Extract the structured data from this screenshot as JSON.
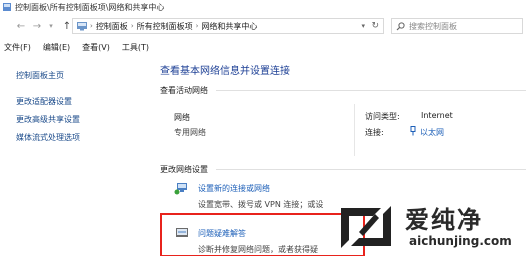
{
  "window": {
    "title": "控制面板\\所有控制面板项\\网络和共享中心"
  },
  "address": {
    "segments": [
      "控制面板",
      "所有控制面板项",
      "网络和共享中心"
    ],
    "search_placeholder": "搜索控制面板"
  },
  "menu": [
    "文件(F)",
    "编辑(E)",
    "查看(V)",
    "工具(T)"
  ],
  "sidebar": {
    "items": [
      {
        "label": "控制面板主页"
      },
      {
        "label": "更改适配器设置"
      },
      {
        "label": "更改高级共享设置"
      },
      {
        "label": "媒体流式处理选项"
      }
    ]
  },
  "main": {
    "heading": "查看基本网络信息并设置连接",
    "active_networks_label": "查看活动网络",
    "network": {
      "name": "网络",
      "type": "专用网络",
      "access_type_label": "访问类型:",
      "access_type_value": "Internet",
      "connections_label": "连接:",
      "connections_value": "以太网"
    },
    "change_settings_label": "更改网络设置",
    "tasks": [
      {
        "title": "设置新的连接或网络",
        "description": "设置宽带、拨号或 VPN 连接；或设",
        "icon": "network-setup-icon"
      },
      {
        "title": "问题疑难解答",
        "description": "诊断并修复网络问题，或者获得疑",
        "icon": "troubleshoot-icon"
      }
    ]
  },
  "watermark": {
    "title": "爱纯净",
    "url": "aichunjing.com"
  },
  "colors": {
    "link": "#1c5fb8",
    "heading": "#1c3f95",
    "highlight_border": "#e8231c"
  }
}
